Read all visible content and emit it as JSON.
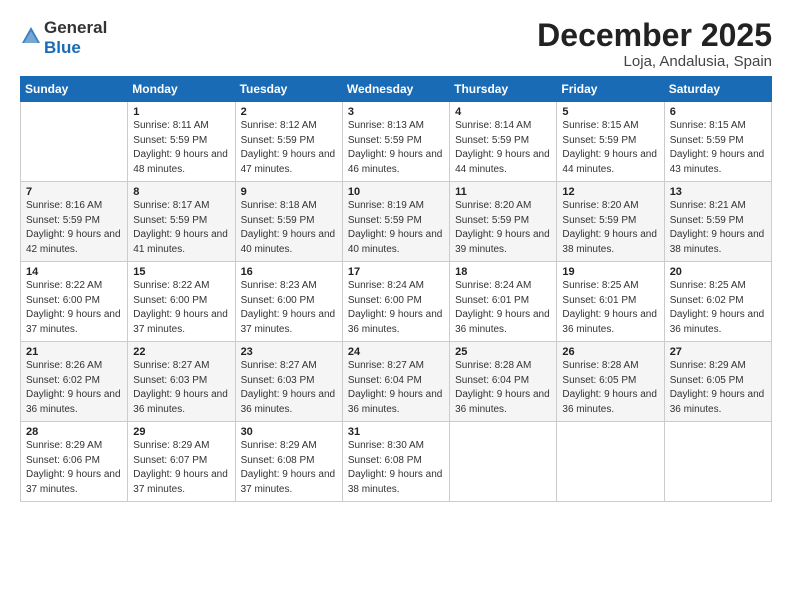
{
  "logo": {
    "general": "General",
    "blue": "Blue"
  },
  "title": "December 2025",
  "location": "Loja, Andalusia, Spain",
  "weekdays": [
    "Sunday",
    "Monday",
    "Tuesday",
    "Wednesday",
    "Thursday",
    "Friday",
    "Saturday"
  ],
  "weeks": [
    [
      {
        "day": "",
        "sunrise": "",
        "sunset": "",
        "daylight": ""
      },
      {
        "day": "1",
        "sunrise": "Sunrise: 8:11 AM",
        "sunset": "Sunset: 5:59 PM",
        "daylight": "Daylight: 9 hours and 48 minutes."
      },
      {
        "day": "2",
        "sunrise": "Sunrise: 8:12 AM",
        "sunset": "Sunset: 5:59 PM",
        "daylight": "Daylight: 9 hours and 47 minutes."
      },
      {
        "day": "3",
        "sunrise": "Sunrise: 8:13 AM",
        "sunset": "Sunset: 5:59 PM",
        "daylight": "Daylight: 9 hours and 46 minutes."
      },
      {
        "day": "4",
        "sunrise": "Sunrise: 8:14 AM",
        "sunset": "Sunset: 5:59 PM",
        "daylight": "Daylight: 9 hours and 44 minutes."
      },
      {
        "day": "5",
        "sunrise": "Sunrise: 8:15 AM",
        "sunset": "Sunset: 5:59 PM",
        "daylight": "Daylight: 9 hours and 44 minutes."
      },
      {
        "day": "6",
        "sunrise": "Sunrise: 8:15 AM",
        "sunset": "Sunset: 5:59 PM",
        "daylight": "Daylight: 9 hours and 43 minutes."
      }
    ],
    [
      {
        "day": "7",
        "sunrise": "Sunrise: 8:16 AM",
        "sunset": "Sunset: 5:59 PM",
        "daylight": "Daylight: 9 hours and 42 minutes."
      },
      {
        "day": "8",
        "sunrise": "Sunrise: 8:17 AM",
        "sunset": "Sunset: 5:59 PM",
        "daylight": "Daylight: 9 hours and 41 minutes."
      },
      {
        "day": "9",
        "sunrise": "Sunrise: 8:18 AM",
        "sunset": "Sunset: 5:59 PM",
        "daylight": "Daylight: 9 hours and 40 minutes."
      },
      {
        "day": "10",
        "sunrise": "Sunrise: 8:19 AM",
        "sunset": "Sunset: 5:59 PM",
        "daylight": "Daylight: 9 hours and 40 minutes."
      },
      {
        "day": "11",
        "sunrise": "Sunrise: 8:20 AM",
        "sunset": "Sunset: 5:59 PM",
        "daylight": "Daylight: 9 hours and 39 minutes."
      },
      {
        "day": "12",
        "sunrise": "Sunrise: 8:20 AM",
        "sunset": "Sunset: 5:59 PM",
        "daylight": "Daylight: 9 hours and 38 minutes."
      },
      {
        "day": "13",
        "sunrise": "Sunrise: 8:21 AM",
        "sunset": "Sunset: 5:59 PM",
        "daylight": "Daylight: 9 hours and 38 minutes."
      }
    ],
    [
      {
        "day": "14",
        "sunrise": "Sunrise: 8:22 AM",
        "sunset": "Sunset: 6:00 PM",
        "daylight": "Daylight: 9 hours and 37 minutes."
      },
      {
        "day": "15",
        "sunrise": "Sunrise: 8:22 AM",
        "sunset": "Sunset: 6:00 PM",
        "daylight": "Daylight: 9 hours and 37 minutes."
      },
      {
        "day": "16",
        "sunrise": "Sunrise: 8:23 AM",
        "sunset": "Sunset: 6:00 PM",
        "daylight": "Daylight: 9 hours and 37 minutes."
      },
      {
        "day": "17",
        "sunrise": "Sunrise: 8:24 AM",
        "sunset": "Sunset: 6:00 PM",
        "daylight": "Daylight: 9 hours and 36 minutes."
      },
      {
        "day": "18",
        "sunrise": "Sunrise: 8:24 AM",
        "sunset": "Sunset: 6:01 PM",
        "daylight": "Daylight: 9 hours and 36 minutes."
      },
      {
        "day": "19",
        "sunrise": "Sunrise: 8:25 AM",
        "sunset": "Sunset: 6:01 PM",
        "daylight": "Daylight: 9 hours and 36 minutes."
      },
      {
        "day": "20",
        "sunrise": "Sunrise: 8:25 AM",
        "sunset": "Sunset: 6:02 PM",
        "daylight": "Daylight: 9 hours and 36 minutes."
      }
    ],
    [
      {
        "day": "21",
        "sunrise": "Sunrise: 8:26 AM",
        "sunset": "Sunset: 6:02 PM",
        "daylight": "Daylight: 9 hours and 36 minutes."
      },
      {
        "day": "22",
        "sunrise": "Sunrise: 8:27 AM",
        "sunset": "Sunset: 6:03 PM",
        "daylight": "Daylight: 9 hours and 36 minutes."
      },
      {
        "day": "23",
        "sunrise": "Sunrise: 8:27 AM",
        "sunset": "Sunset: 6:03 PM",
        "daylight": "Daylight: 9 hours and 36 minutes."
      },
      {
        "day": "24",
        "sunrise": "Sunrise: 8:27 AM",
        "sunset": "Sunset: 6:04 PM",
        "daylight": "Daylight: 9 hours and 36 minutes."
      },
      {
        "day": "25",
        "sunrise": "Sunrise: 8:28 AM",
        "sunset": "Sunset: 6:04 PM",
        "daylight": "Daylight: 9 hours and 36 minutes."
      },
      {
        "day": "26",
        "sunrise": "Sunrise: 8:28 AM",
        "sunset": "Sunset: 6:05 PM",
        "daylight": "Daylight: 9 hours and 36 minutes."
      },
      {
        "day": "27",
        "sunrise": "Sunrise: 8:29 AM",
        "sunset": "Sunset: 6:05 PM",
        "daylight": "Daylight: 9 hours and 36 minutes."
      }
    ],
    [
      {
        "day": "28",
        "sunrise": "Sunrise: 8:29 AM",
        "sunset": "Sunset: 6:06 PM",
        "daylight": "Daylight: 9 hours and 37 minutes."
      },
      {
        "day": "29",
        "sunrise": "Sunrise: 8:29 AM",
        "sunset": "Sunset: 6:07 PM",
        "daylight": "Daylight: 9 hours and 37 minutes."
      },
      {
        "day": "30",
        "sunrise": "Sunrise: 8:29 AM",
        "sunset": "Sunset: 6:08 PM",
        "daylight": "Daylight: 9 hours and 37 minutes."
      },
      {
        "day": "31",
        "sunrise": "Sunrise: 8:30 AM",
        "sunset": "Sunset: 6:08 PM",
        "daylight": "Daylight: 9 hours and 38 minutes."
      },
      {
        "day": "",
        "sunrise": "",
        "sunset": "",
        "daylight": ""
      },
      {
        "day": "",
        "sunrise": "",
        "sunset": "",
        "daylight": ""
      },
      {
        "day": "",
        "sunrise": "",
        "sunset": "",
        "daylight": ""
      }
    ]
  ]
}
